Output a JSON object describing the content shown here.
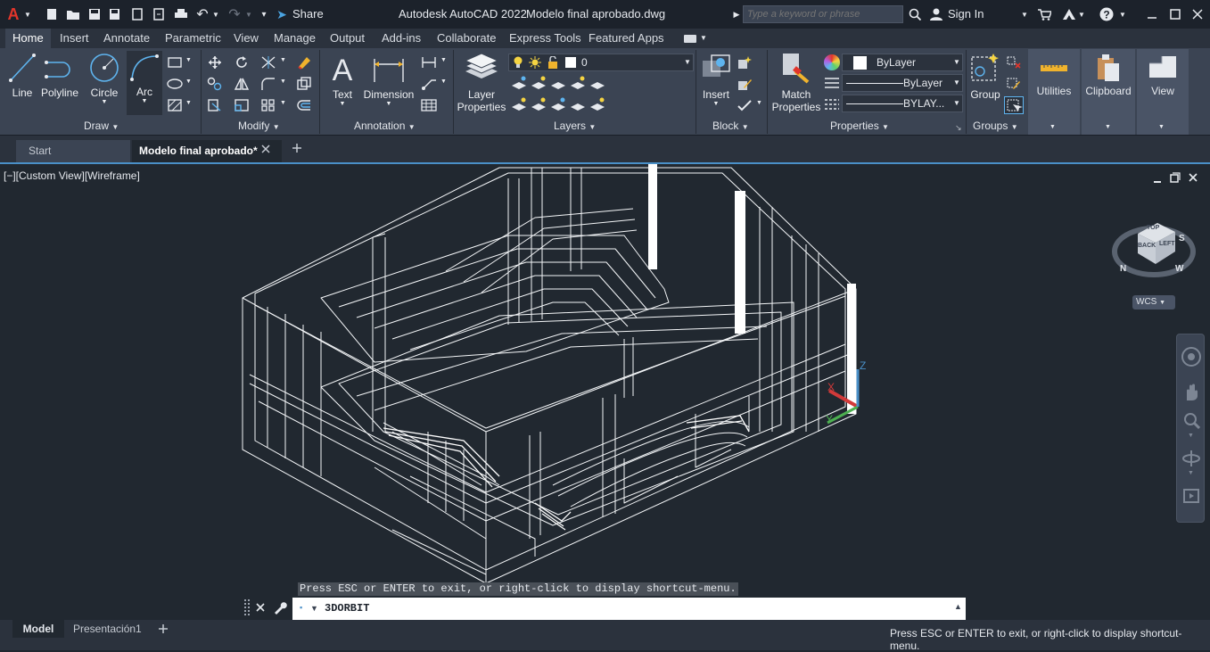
{
  "app": {
    "title": "Autodesk AutoCAD 2022",
    "file": "Modelo final aprobado.dwg",
    "share": "Share",
    "search_placeholder": "Type a keyword or phrase",
    "sign_in": "Sign In"
  },
  "ribbon_tabs": [
    "Home",
    "Insert",
    "Annotate",
    "Parametric",
    "View",
    "Manage",
    "Output",
    "Add-ins",
    "Collaborate",
    "Express Tools",
    "Featured Apps"
  ],
  "draw": {
    "line": "Line",
    "polyline": "Polyline",
    "circle": "Circle",
    "arc": "Arc",
    "panel": "Draw"
  },
  "modify": {
    "panel": "Modify"
  },
  "annotation": {
    "text": "Text",
    "dimension": "Dimension",
    "panel": "Annotation"
  },
  "layers": {
    "layer_properties_1": "Layer",
    "layer_properties_2": "Properties",
    "current_layer": "0",
    "panel": "Layers"
  },
  "block": {
    "insert": "Insert",
    "panel": "Block"
  },
  "properties": {
    "match_1": "Match",
    "match_2": "Properties",
    "color": "ByLayer",
    "linetype": "ByLayer",
    "lineweight": "BYLAY...",
    "panel": "Properties"
  },
  "groups": {
    "group": "Group",
    "panel": "Groups"
  },
  "utilities": "Utilities",
  "clipboard": "Clipboard",
  "view_btn": "View",
  "doc_tabs": {
    "start": "Start",
    "active": "Modelo final aprobado*"
  },
  "viewport": {
    "label": "[−][Custom View][Wireframe]",
    "wcs": "WCS",
    "cube_top": "TOP",
    "cube_front": "BACK",
    "cube_right": "LEFT",
    "compass_n": "N",
    "compass_s": "S",
    "compass_w": "W"
  },
  "command": {
    "prompt": "Press ESC or ENTER to exit, or right-click to display shortcut-menu.",
    "current": "3DORBIT"
  },
  "layout_tabs": {
    "model": "Model",
    "layout1": "Presentación1"
  },
  "status": "Press ESC or ENTER to exit, or right-click to display shortcut-menu.",
  "colors": {
    "accent": "#4a90c8",
    "ribbon": "#3b4453",
    "viewport": "#212830",
    "titlebar": "#1c222b"
  }
}
